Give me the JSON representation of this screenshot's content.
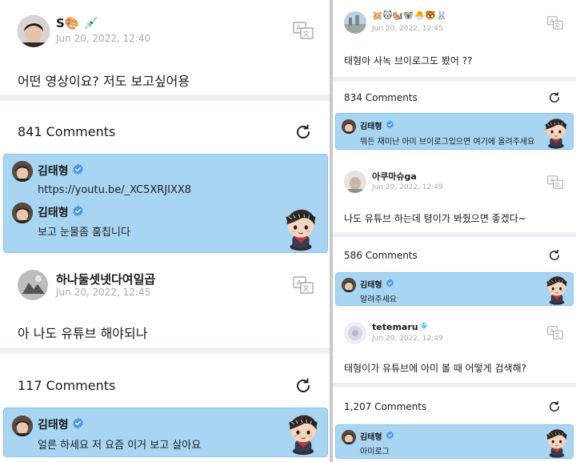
{
  "left": {
    "post1": {
      "username": "S🎨 💉",
      "date": "Jun 20, 2022, 12:40",
      "text": "어떤 영상이요? 저도 보고싶어용",
      "comments_count": "841 Comments",
      "replies": [
        {
          "name": "김태형",
          "text": "https://youtu.be/_XC5XRJIXX8"
        },
        {
          "name": "김태형",
          "text": "보고 눈물좀 훔칩니다"
        }
      ]
    },
    "post2": {
      "username": "하나둘셋넷다여일곱",
      "date": "Jun 20, 2022, 12:45",
      "text": "아 나도 유튜브 해야되나",
      "comments_count": "117 Comments",
      "replies": [
        {
          "name": "김태형",
          "text": "얼른 하세요 저 요즘 이거 보고 살아요"
        }
      ]
    }
  },
  "right": {
    "post1": {
      "username": "🐹🐱🐿️🐨🐣🐯🐰",
      "date": "Jun 20, 2022, 12:45",
      "text": "태형아 사녹 브이로그도 봤어 ??",
      "comments_count": "834 Comments",
      "replies": [
        {
          "name": "김태형",
          "text": "뭐든 재미난 아미 브이로그있으면 여기에 올려주세요"
        }
      ]
    },
    "post2": {
      "username": "아쿠마슈ga",
      "date": "Jun 20, 2022, 12:49",
      "text": "나도 유튜브 하는데 텽이가 봐줬으면 좋겠다~",
      "comments_count": "586 Comments",
      "replies": [
        {
          "name": "김태형",
          "text": "알려주세요"
        }
      ]
    },
    "post3": {
      "username": "tetemaru‍‍🎐",
      "date": "Jun 20, 2022, 12:49",
      "text": "태형이가 유튜브에 아미 볼 때 어떻게 검색해?",
      "comments_count": "1,207 Comments",
      "replies": [
        {
          "name": "김태형",
          "text": "아미로그"
        }
      ]
    }
  },
  "icons": {
    "translate": "translate-icon",
    "refresh": "refresh-icon",
    "verified": "verified-badge-icon"
  },
  "colors": {
    "reply_bg": "#a8d5f2",
    "separator": "#eef0f6",
    "verified": "#4a9ae0"
  }
}
